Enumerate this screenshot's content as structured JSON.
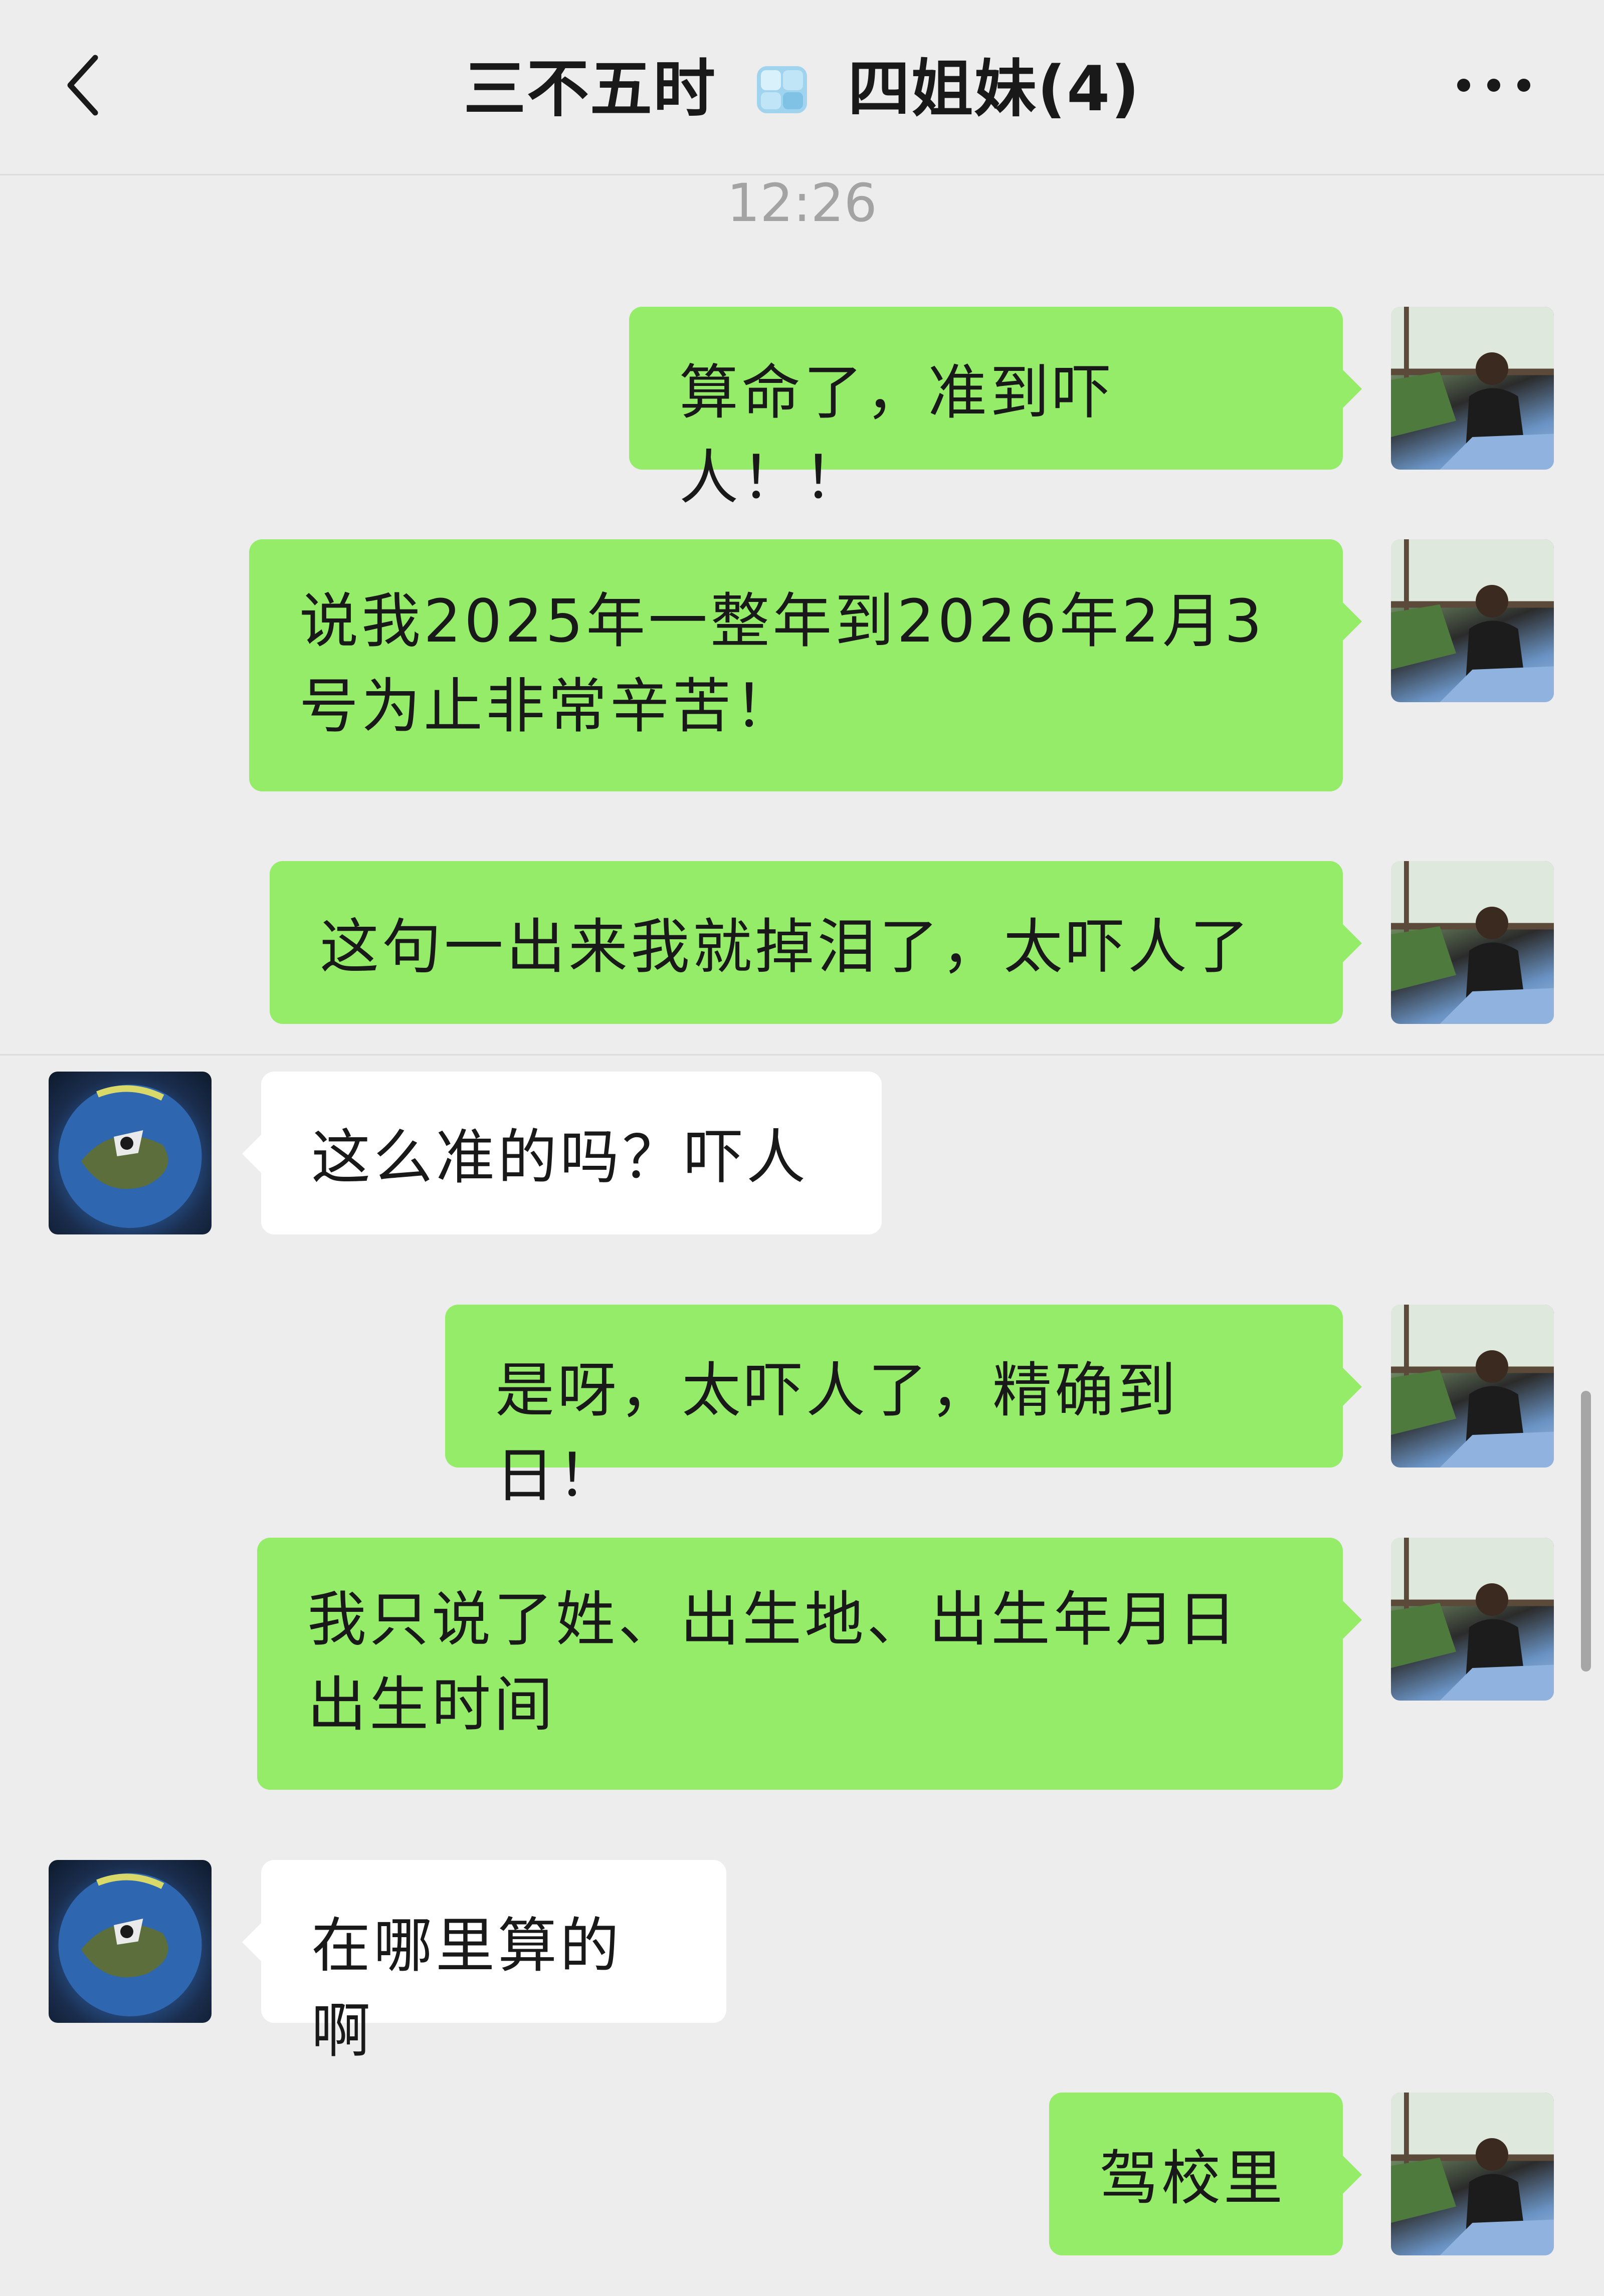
{
  "header": {
    "title_left": "三不五时",
    "title_right": "四姐妹(4)",
    "back_icon": "chevron-left-icon",
    "emoji_icon": "ice-cube-icon",
    "more_icon": "more-dots-icon"
  },
  "timestamp": "12:26",
  "messages": [
    {
      "sender": "me",
      "text": "算命了，准到吓人！！"
    },
    {
      "sender": "me",
      "text": "说我2025年一整年到2026年2月3号为止非常辛苦！"
    },
    {
      "sender": "me",
      "text": "这句一出来我就掉泪了，太吓人了"
    },
    {
      "sender": "friend",
      "text": "这么准的吗？吓人"
    },
    {
      "sender": "me",
      "text": "是呀，太吓人了，精确到日！"
    },
    {
      "sender": "me",
      "text": "我只说了姓、出生地、出生年月日出生时间"
    },
    {
      "sender": "friend",
      "text": "在哪里算的啊"
    },
    {
      "sender": "me",
      "text": "驾校里"
    }
  ],
  "colors": {
    "background": "#ededed",
    "my_bubble": "#95ec69",
    "friend_bubble": "#ffffff",
    "timestamp": "#a3a3a3"
  }
}
